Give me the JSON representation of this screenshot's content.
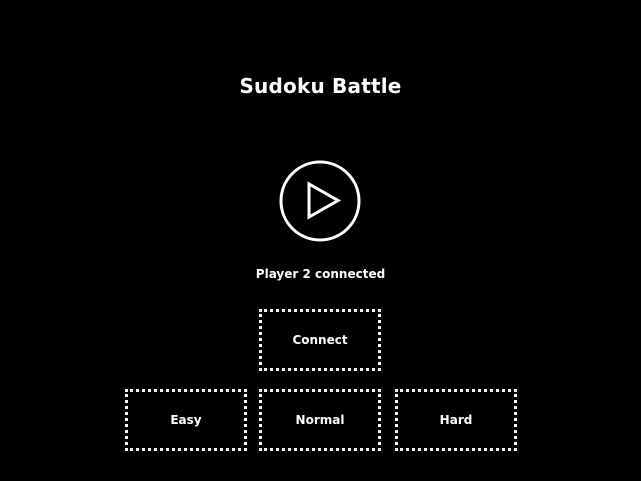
{
  "game": {
    "title": "Sudoku Battle",
    "status": "Player 2 connected"
  },
  "play": {
    "icon": "play-icon"
  },
  "buttons": {
    "connect_label": "Connect",
    "easy_label": "Easy",
    "normal_label": "Normal",
    "hard_label": "Hard"
  },
  "colors": {
    "background": "#000000",
    "foreground": "#ffffff"
  }
}
